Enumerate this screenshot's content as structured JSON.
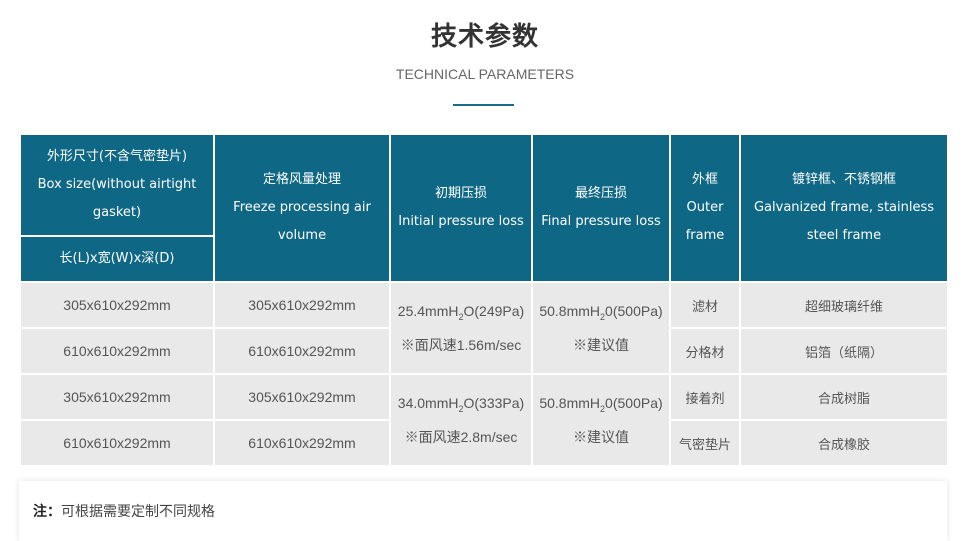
{
  "heading": {
    "title": "技术参数",
    "subtitle": "TECHNICAL PARAMETERS",
    "accent_color": "#1a6a8a"
  },
  "table": {
    "header_color": "#0f6786",
    "cell_color": "#e9e9e9",
    "headers": {
      "box_size_cn": "外形尺寸(不含气密垫片)",
      "box_size_en1": "Box size(without airtight",
      "box_size_en2": "gasket)",
      "box_size_unit": "长(L)x宽(W)x深(D)",
      "freeze_cn": "定格风量处理",
      "freeze_en1": "Freeze processing air",
      "freeze_en2": "volume",
      "initial_cn": "初期压损",
      "initial_en": "Initial pressure loss",
      "final_cn": "最终压损",
      "final_en": "Final pressure loss",
      "outer_cn": "外框",
      "outer_en1": "Outer",
      "outer_en2": "frame",
      "frame_cn": "镀锌框、不锈钢框",
      "frame_en1": "Galvanized frame, stainless",
      "frame_en2": "steel frame"
    },
    "rows": [
      {
        "box_size": "305x610x292mm",
        "air_volume": "305x610x292mm",
        "component": "滤材",
        "material": "超细玻璃纤维"
      },
      {
        "box_size": "610x610x292mm",
        "air_volume": "610x610x292mm",
        "component": "分格材",
        "material": "铝箔（纸隔）"
      },
      {
        "box_size": "305x610x292mm",
        "air_volume": "305x610x292mm",
        "component": "接着剂",
        "material": "合成树脂"
      },
      {
        "box_size": "610x610x292mm",
        "air_volume": "610x610x292mm",
        "component": "气密垫片",
        "material": "合成橡胶"
      }
    ],
    "groups": [
      {
        "initial_a": "25.4mmH",
        "initial_sub": "2",
        "initial_b": "O(249Pa)",
        "initial_note": "※面风速1.56m/sec",
        "final_a": "50.8mmH",
        "final_sub": "2",
        "final_b": "0(500Pa)",
        "final_note": "※建议值"
      },
      {
        "initial_a": "34.0mmH",
        "initial_sub": "2",
        "initial_b": "O(333Pa)",
        "initial_note": "※面风速2.8m/sec",
        "final_a": "50.8mmH",
        "final_sub": "2",
        "final_b": "0(500Pa)",
        "final_note": "※建议值"
      }
    ]
  },
  "note": {
    "label": "注：",
    "text": "可根据需要定制不同规格"
  }
}
